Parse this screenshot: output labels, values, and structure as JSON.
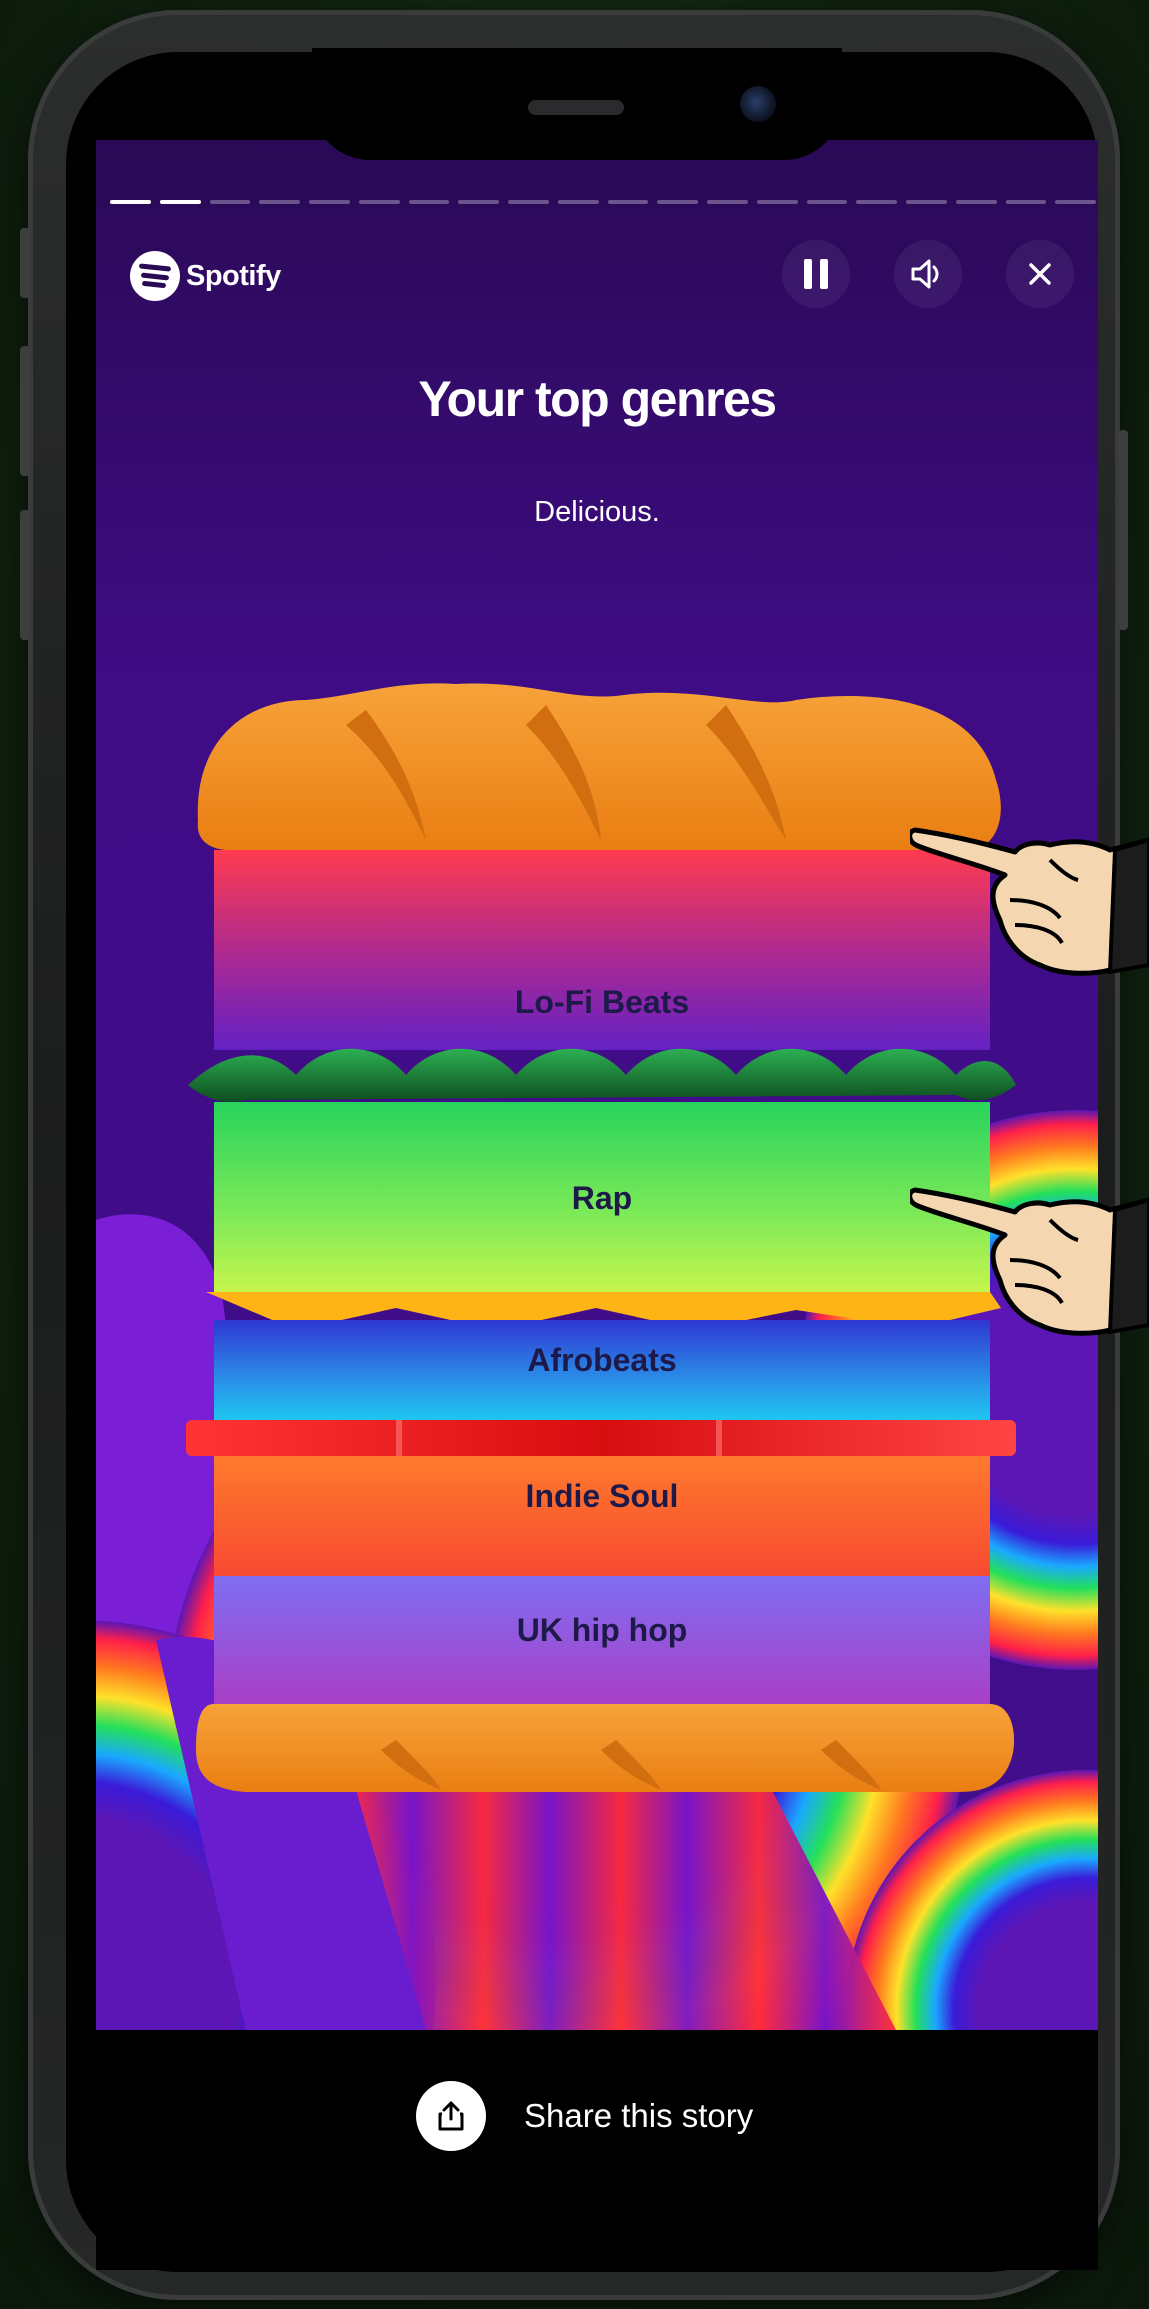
{
  "app": {
    "brand": "Spotify"
  },
  "story": {
    "progress": {
      "segments": 20,
      "completed": 2
    },
    "title": "Your top genres",
    "subtitle": "Delicious.",
    "controls": {
      "pause": "pause-icon",
      "volume": "volume-icon",
      "close": "close-icon"
    }
  },
  "genres": [
    {
      "label": "Lo-Fi Beats"
    },
    {
      "label": "Rap"
    },
    {
      "label": "Afrobeats"
    },
    {
      "label": "Indie Soul"
    },
    {
      "label": "UK hip hop"
    }
  ],
  "share": {
    "label": "Share this story",
    "icon": "share-icon"
  },
  "colors": {
    "background": "#420e8d",
    "bread": "#f2921a",
    "lettuce": "#1e7a32",
    "tomato": "#e0161a",
    "cheese": "#ffb415"
  }
}
